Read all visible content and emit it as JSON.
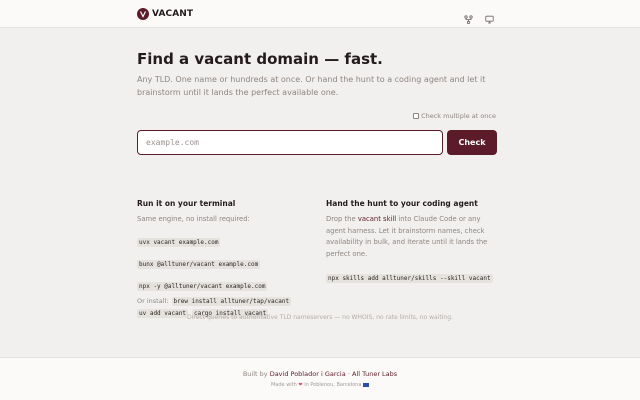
{
  "header": {
    "brand_name": "VACANT",
    "icons": [
      "git-branch-icon",
      "monitor-icon"
    ]
  },
  "hero": {
    "title": "Find a vacant domain — fast.",
    "subtitle": "Any TLD. One name or hundreds at once. Or hand the hunt to a coding agent and let it brainstorm until it lands the perfect available one."
  },
  "search": {
    "multiple_label": "Check multiple at once",
    "multiple_checked": false,
    "placeholder": "example.com",
    "value": "",
    "button_label": "Check"
  },
  "terminal": {
    "heading": "Run it on your terminal",
    "intro": "Same engine, no install required:",
    "commands": [
      "uvx vacant example.com",
      "bunx @alltuner/vacant example.com",
      "npx -y @alltuner/vacant example.com"
    ],
    "install_label": "Or install:",
    "install_commands": [
      "brew install alltuner/tap/vacant",
      "uv add vacant",
      "cargo install vacant"
    ]
  },
  "agent": {
    "heading": "Hand the hunt to your coding agent",
    "text_before": "Drop the ",
    "link": "vacant skill",
    "text_after": " into Claude Code or any agent harness. Let it brainstorm names, check availability in bulk, and iterate until it lands the perfect one.",
    "command": "npx skills add alltuner/skills --skill vacant"
  },
  "footnote": "Direct queries to authoritative TLD nameservers — no WHOIS, no rate limits, no waiting.",
  "footer": {
    "built_by": "Built by",
    "author": "David Poblador i Garcia",
    "separator": "·",
    "company": "All Tuner Labs",
    "made_with": "Made with",
    "heart": "❤",
    "made_in": "in Poblenou, Barcelona"
  }
}
